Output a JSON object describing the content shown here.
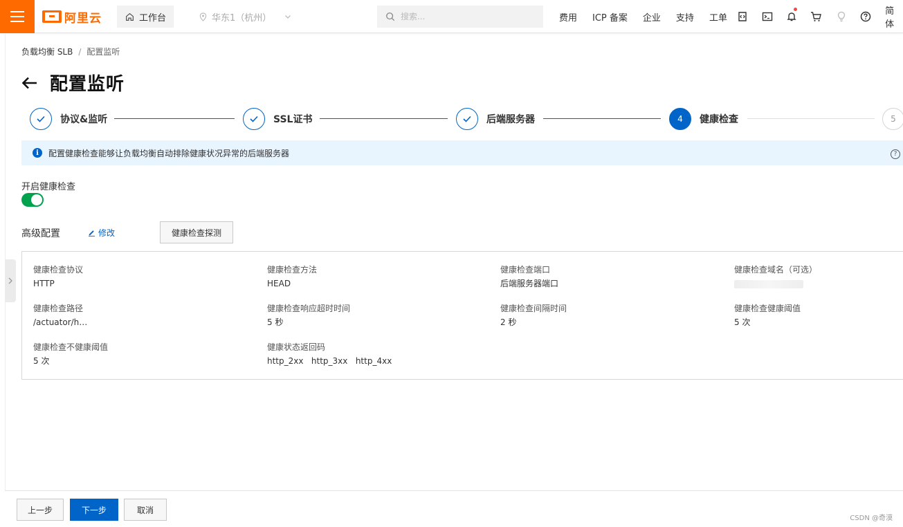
{
  "topbar": {
    "logo_text": "阿里云",
    "workbench_label": "工作台",
    "region_label": "华东1（杭州）",
    "search_placeholder": "搜索...",
    "links": [
      "费用",
      "ICP 备案",
      "企业",
      "支持",
      "工单"
    ],
    "lang": "简体",
    "brand_color": "#ff6a00"
  },
  "breadcrumb": {
    "parent": "负载均衡 SLB",
    "separator": "/",
    "current": "配置监听"
  },
  "page": {
    "title": "配置监听"
  },
  "steps": [
    {
      "label": "协议&监听",
      "state": "done"
    },
    {
      "label": "SSL证书",
      "state": "done"
    },
    {
      "label": "后端服务器",
      "state": "done"
    },
    {
      "label": "健康检查",
      "state": "active",
      "number": "4"
    },
    {
      "label": "",
      "state": "pending",
      "number": "5"
    }
  ],
  "info_banner": {
    "text": "配置健康检查能够让负载均衡自动排除健康状况异常的后端服务器"
  },
  "health_check": {
    "toggle_label": "开启健康检查",
    "enabled": true
  },
  "advanced": {
    "title": "高级配置",
    "edit_label": "修改",
    "probe_button": "健康检查探测",
    "items": [
      {
        "label": "健康检查协议",
        "value": "HTTP"
      },
      {
        "label": "健康检查方法",
        "value": "HEAD"
      },
      {
        "label": "健康检查端口",
        "value": "后端服务器端口"
      },
      {
        "label": "健康检查域名（可选）",
        "value": ""
      },
      {
        "label": "健康检查路径",
        "value": "/actuator/h…"
      },
      {
        "label": "健康检查响应超时时间",
        "value": "5 秒"
      },
      {
        "label": "健康检查间隔时间",
        "value": "2 秒"
      },
      {
        "label": "健康检查健康阈值",
        "value": "5 次"
      },
      {
        "label": "健康检查不健康阈值",
        "value": "5 次"
      },
      {
        "label": "健康状态返回码",
        "value": "http_2xx   http_3xx   http_4xx"
      }
    ]
  },
  "footer": {
    "prev": "上一步",
    "next": "下一步",
    "cancel": "取消",
    "watermark": "CSDN @奇漠"
  },
  "colors": {
    "primary": "#0064c8",
    "success": "#00a24d",
    "info_bg": "#e8f4fe"
  }
}
